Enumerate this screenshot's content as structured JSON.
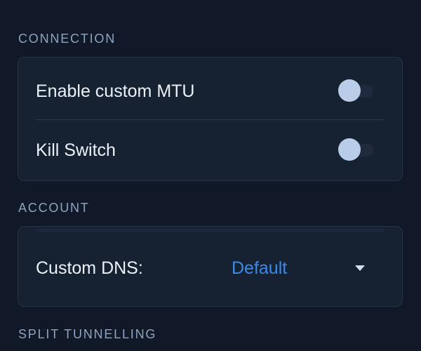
{
  "sections": {
    "connection": {
      "title": "CONNECTION",
      "items": [
        {
          "label": "Enable custom MTU",
          "toggle_on": false
        },
        {
          "label": "Kill Switch",
          "toggle_on": false
        }
      ]
    },
    "account": {
      "title": "ACCOUNT",
      "dns": {
        "label": "Custom DNS:",
        "value": "Default"
      }
    },
    "split_tunnelling": {
      "title": "SPLIT TUNNELLING"
    }
  },
  "colors": {
    "background": "#111827",
    "card": "#162132",
    "section_header": "#8fa3c0",
    "accent": "#3c8ae6",
    "toggle_knob": "#b9cde9"
  },
  "icons": {
    "dropdown": "chevron-down-icon"
  }
}
